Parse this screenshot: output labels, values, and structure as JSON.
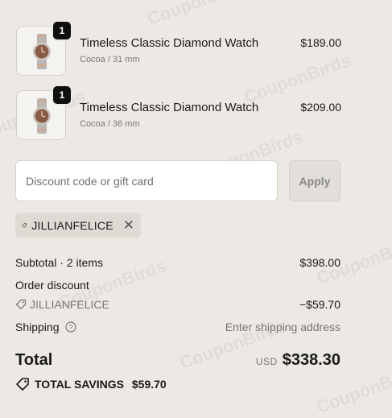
{
  "items": [
    {
      "quantity": "1",
      "title": "Timeless Classic Diamond Watch",
      "variant": "Cocoa / 31 mm",
      "price": "$189.00"
    },
    {
      "quantity": "1",
      "title": "Timeless Classic Diamond Watch",
      "variant": "Cocoa / 36 mm",
      "price": "$209.00"
    }
  ],
  "discount": {
    "placeholder": "Discount code or gift card",
    "apply_label": "Apply",
    "applied_code": "JILLIANFELICE"
  },
  "summary": {
    "subtotal_label": "Subtotal · 2 items",
    "subtotal_value": "$398.00",
    "order_discount_label": "Order discount",
    "discount_code": "JILLIANFELICE",
    "discount_value": "−$59.70",
    "shipping_label": "Shipping",
    "shipping_value": "Enter shipping address",
    "total_label": "Total",
    "currency": "USD",
    "total_value": "$338.30",
    "savings_label": "TOTAL SAVINGS",
    "savings_value": "$59.70"
  },
  "watermark_text": "CouponBirds",
  "colors": {
    "background": "#ece9e4",
    "badge": "#0f0f0f",
    "chip": "#dedad4"
  }
}
